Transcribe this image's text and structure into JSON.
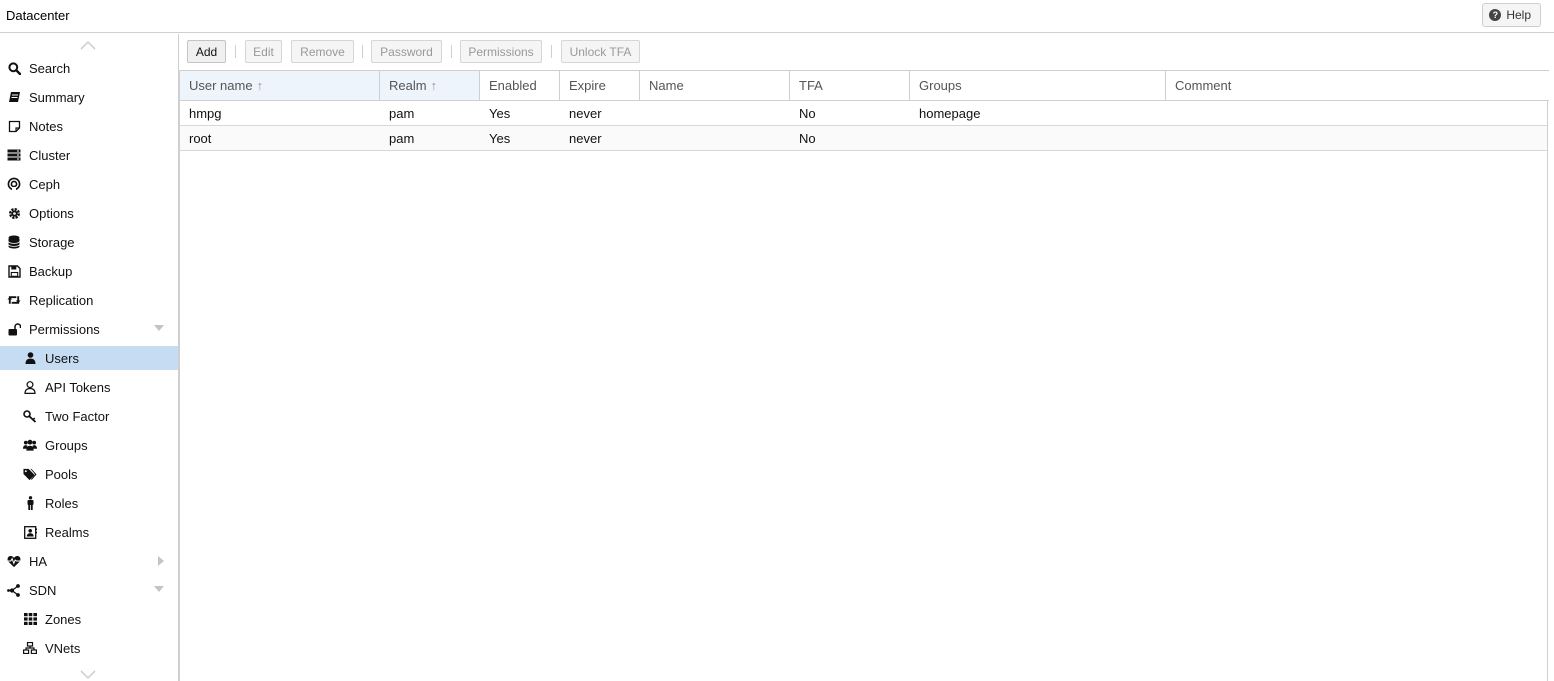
{
  "header": {
    "title": "Datacenter",
    "help_label": "Help"
  },
  "sidebar": {
    "items": [
      {
        "label": "Search",
        "icon": "search-icon",
        "level": "top"
      },
      {
        "label": "Summary",
        "icon": "book-icon",
        "level": "top"
      },
      {
        "label": "Notes",
        "icon": "notes-icon",
        "level": "top"
      },
      {
        "label": "Cluster",
        "icon": "server-icon",
        "level": "top"
      },
      {
        "label": "Ceph",
        "icon": "ceph-icon",
        "level": "top"
      },
      {
        "label": "Options",
        "icon": "gear-icon",
        "level": "top"
      },
      {
        "label": "Storage",
        "icon": "database-icon",
        "level": "top"
      },
      {
        "label": "Backup",
        "icon": "floppy-icon",
        "level": "top"
      },
      {
        "label": "Replication",
        "icon": "retweet-icon",
        "level": "top"
      },
      {
        "label": "Permissions",
        "icon": "unlock-icon",
        "level": "top",
        "expander": "down"
      },
      {
        "label": "Users",
        "icon": "user-icon",
        "level": "sub",
        "selected": true
      },
      {
        "label": "API Tokens",
        "icon": "user-outline-icon",
        "level": "sub"
      },
      {
        "label": "Two Factor",
        "icon": "key-icon",
        "level": "sub"
      },
      {
        "label": "Groups",
        "icon": "users-icon",
        "level": "sub"
      },
      {
        "label": "Pools",
        "icon": "tags-icon",
        "level": "sub"
      },
      {
        "label": "Roles",
        "icon": "male-icon",
        "level": "sub"
      },
      {
        "label": "Realms",
        "icon": "address-book-icon",
        "level": "sub"
      },
      {
        "label": "HA",
        "icon": "heartbeat-icon",
        "level": "top",
        "expander": "right"
      },
      {
        "label": "SDN",
        "icon": "sdn-icon",
        "level": "top",
        "expander": "down"
      },
      {
        "label": "Zones",
        "icon": "th-icon",
        "level": "sub"
      },
      {
        "label": "VNets",
        "icon": "sitemap-icon",
        "level": "sub"
      }
    ]
  },
  "toolbar": {
    "add": "Add",
    "edit": "Edit",
    "remove": "Remove",
    "password": "Password",
    "permissions": "Permissions",
    "unlock_tfa": "Unlock TFA"
  },
  "grid": {
    "columns": [
      "User name",
      "Realm",
      "Enabled",
      "Expire",
      "Name",
      "TFA",
      "Groups",
      "Comment"
    ],
    "rows": [
      [
        "hmpg",
        "pam",
        "Yes",
        "never",
        "",
        "No",
        "homepage",
        ""
      ],
      [
        "root",
        "pam",
        "Yes",
        "never",
        "",
        "No",
        "",
        ""
      ]
    ]
  },
  "colors": {
    "selected_row": "#c6dcf2",
    "sorted_header": "#eef4fb"
  }
}
